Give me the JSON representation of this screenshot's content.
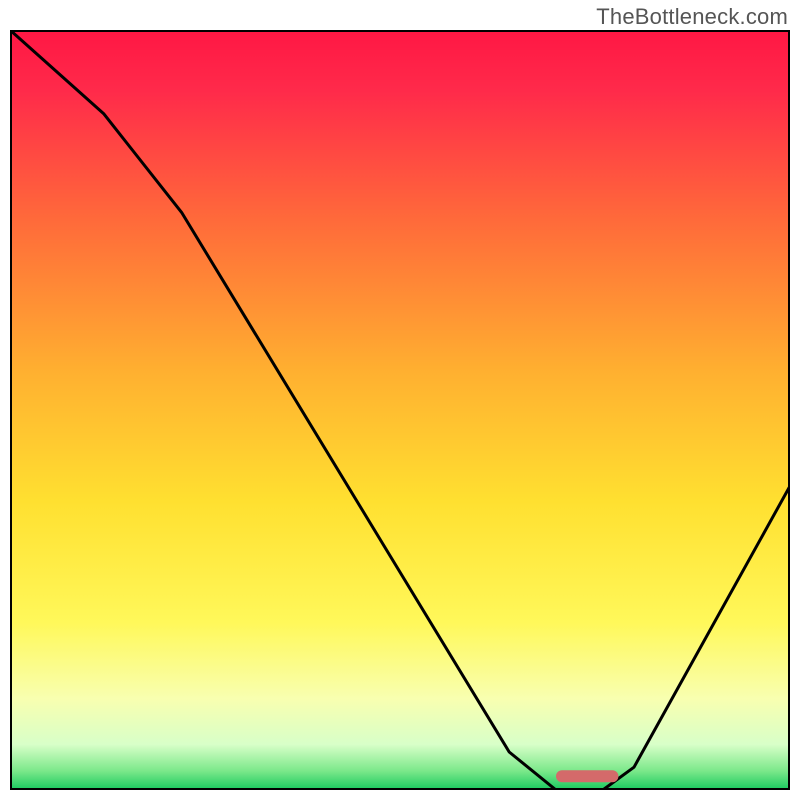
{
  "watermark": "TheBottleneck.com",
  "chart_data": {
    "type": "line",
    "title": "",
    "xlabel": "",
    "ylabel": "",
    "xlim": [
      0,
      100
    ],
    "ylim": [
      0,
      100
    ],
    "grid": false,
    "legend": false,
    "series": [
      {
        "name": "curve",
        "x": [
          0,
          12,
          22,
          64,
          70,
          76,
          80,
          100
        ],
        "y": [
          100,
          89,
          76,
          5,
          0,
          0,
          3,
          40
        ]
      }
    ],
    "optimal_marker": {
      "x_start": 70,
      "x_end": 78,
      "y": 1.8,
      "color": "#d46a6a"
    },
    "background_gradient": {
      "stops": [
        {
          "pos": 0.0,
          "color": "#ff1744"
        },
        {
          "pos": 0.08,
          "color": "#ff2a4a"
        },
        {
          "pos": 0.25,
          "color": "#ff6a3a"
        },
        {
          "pos": 0.45,
          "color": "#ffb030"
        },
        {
          "pos": 0.62,
          "color": "#ffe030"
        },
        {
          "pos": 0.78,
          "color": "#fff85a"
        },
        {
          "pos": 0.88,
          "color": "#f8ffb0"
        },
        {
          "pos": 0.94,
          "color": "#d8ffc8"
        },
        {
          "pos": 0.975,
          "color": "#7be88a"
        },
        {
          "pos": 1.0,
          "color": "#18c95e"
        }
      ]
    },
    "frame_stroke": "#000000",
    "curve_stroke": "#000000",
    "curve_width": 3
  }
}
